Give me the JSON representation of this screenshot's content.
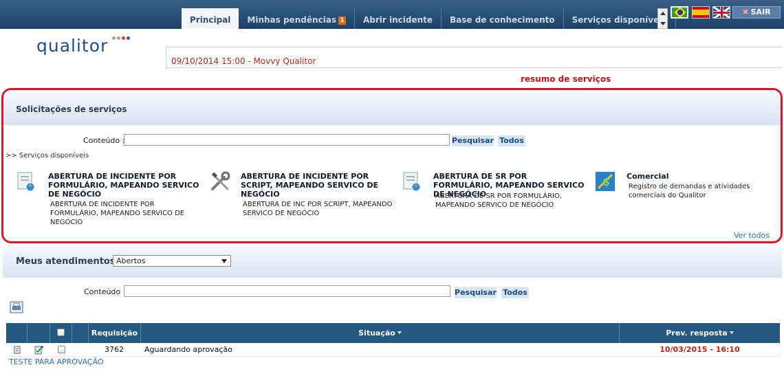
{
  "tabs": [
    {
      "label": "Principal",
      "active": true
    },
    {
      "label": "Minhas pendências",
      "badge": "1"
    },
    {
      "label": "Abrir incidente"
    },
    {
      "label": "Base de conhecimento"
    },
    {
      "label": "Serviços disponíveis"
    }
  ],
  "header": {
    "exit_label": "SAIR",
    "flags": [
      "flag-brazil-icon",
      "flag-spain-icon",
      "flag-uk-icon"
    ]
  },
  "logo": {
    "text": "qualitor"
  },
  "notice": {
    "text": "09/10/2014 15:00 - Movvy Qualitor"
  },
  "annotation": {
    "text": "resumo de serviços"
  },
  "services_panel": {
    "title": "Solicitações de serviços",
    "search_label": "Conteúdo :",
    "search_value": "",
    "search_button": "Pesquisar",
    "all_button": "Todos",
    "breadcrumb": ">> Serviços disponíveis",
    "items": [
      {
        "title": "ABERTURA DE INCIDENTE POR FORMULÁRIO, MAPEANDO SERVICO DE NEGÓCIO",
        "description": "ABERTURA DE INCIDENTE POR FORMULÁRIO, MAPEANDO SERVICO DE NEGÓCIO",
        "icon": "form-document-icon"
      },
      {
        "title": "ABERTURA DE INCIDENTE POR SCRIPT, MAPEANDO SERVICO DE NEGÓCIO",
        "description": "ABERTURA DE INC POR SCRIPT, MAPEANDO SERVICO DE NEGÓCIO",
        "icon": "tools-icon"
      },
      {
        "title": "ABERTURA DE SR POR FORMULÁRIO, MAPEANDO SERVICO DE NEGÓCIO",
        "description": "ABERTURA DE SR POR FORMULÁRIO, MAPEANDO SERVICO DE NEGÓCIO",
        "icon": "form-document-icon"
      },
      {
        "title": "Comercial",
        "description": "Registro de demandas e atividades comerciais do Qualitor",
        "icon": "money-icon"
      }
    ],
    "see_all": "Ver todos >>"
  },
  "attendances": {
    "title": "Meus atendimentos :",
    "filter_value": "Abertos",
    "search_label": "Conteúdo :",
    "search_value": "",
    "search_button": "Pesquisar",
    "all_button": "Todos",
    "columns": [
      "Requisição",
      "Situação",
      "Prev. resposta"
    ],
    "rows": [
      {
        "requisicao": "3762",
        "situacao": "Aguardando aprovação",
        "prev_resposta": "10/03/2015 - 16:10",
        "subtitle": "TESTE PARA APROVAÇÃO"
      }
    ]
  },
  "colors": {
    "accent": "#23587f",
    "highlight": "#e0152a",
    "deadline": "#c0261a"
  }
}
